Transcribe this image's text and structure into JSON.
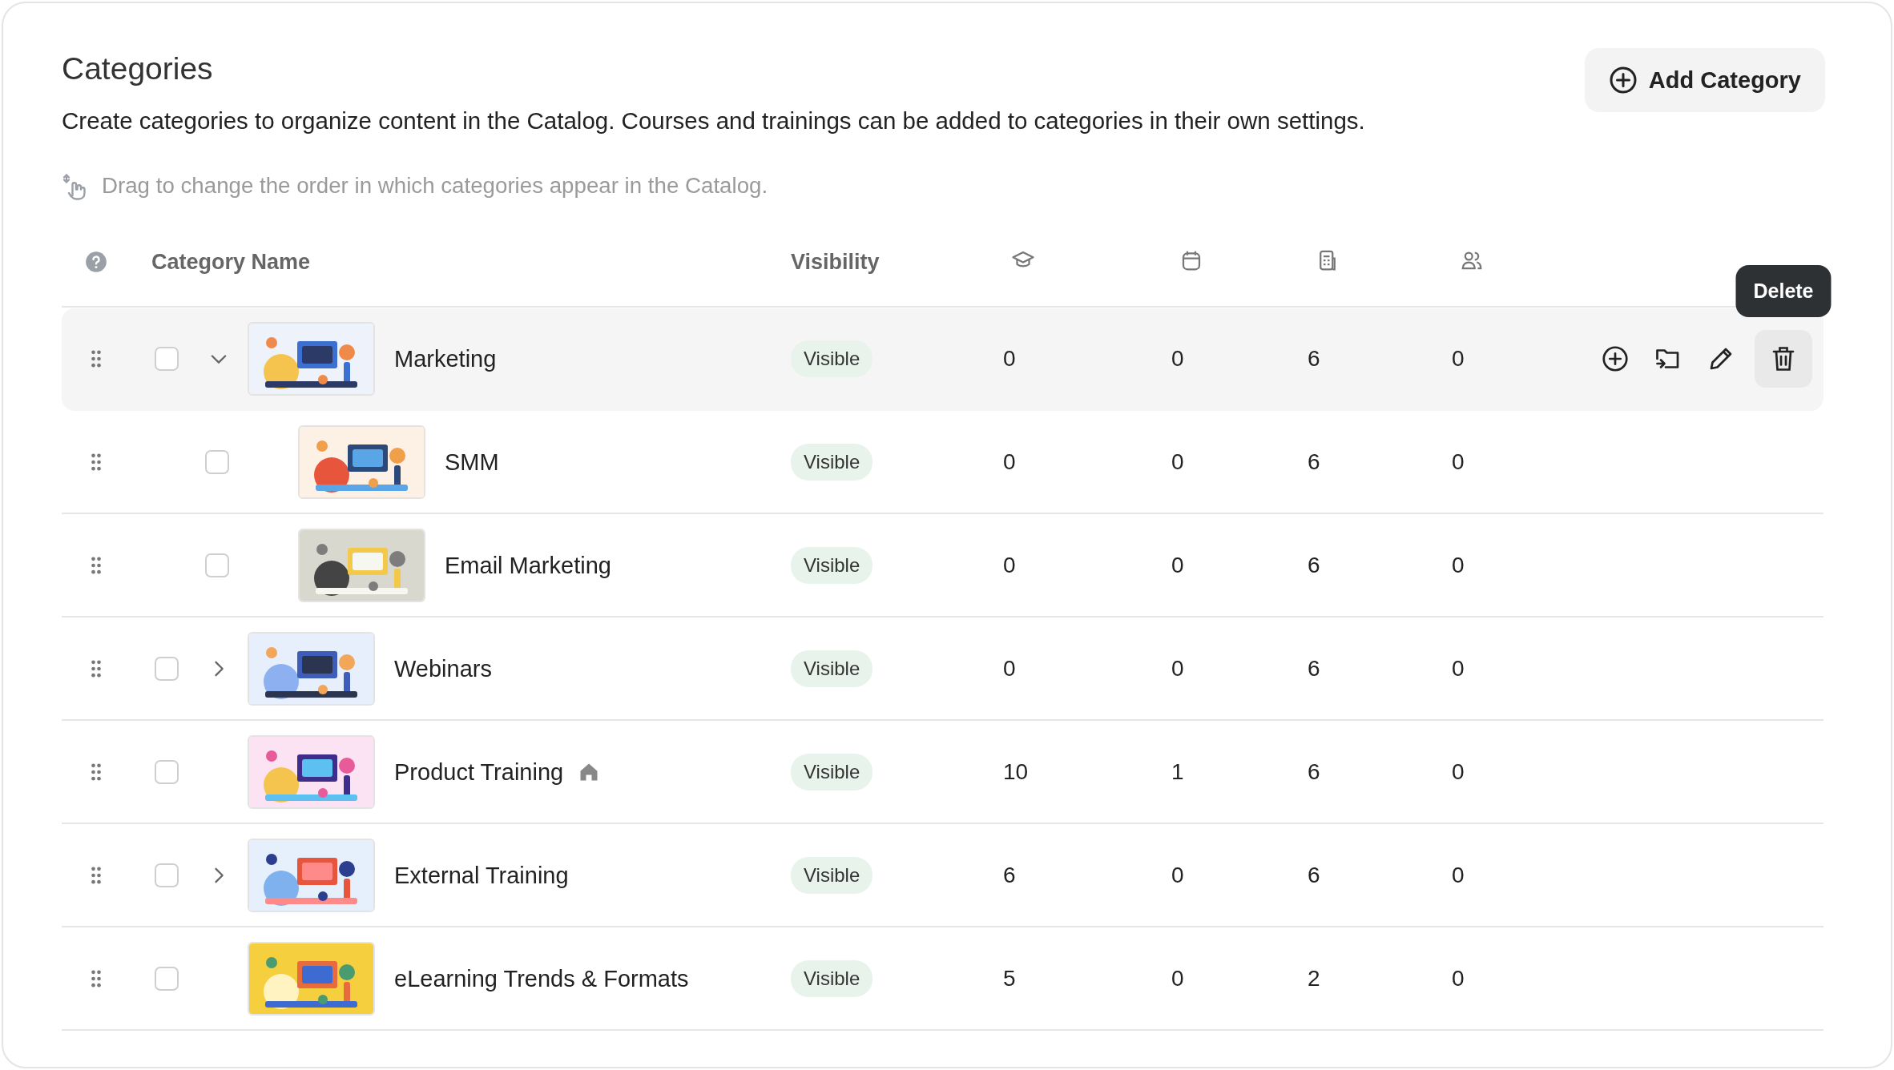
{
  "header": {
    "title": "Categories",
    "description": "Create categories to organize content in the Catalog. Courses and trainings can be added to categories in their own settings.",
    "hint": "Drag to change the order in which categories appear in the Catalog.",
    "add_button": "Add Category"
  },
  "table": {
    "columns": [
      {
        "label": "Category Name"
      },
      {
        "label": "Visibility"
      }
    ],
    "rows": [
      {
        "name": "Marketing",
        "visibility": "Visible",
        "counts": [
          "0",
          "0",
          "6",
          "0"
        ],
        "checked": false,
        "expanded": true,
        "home": false,
        "hovered": true,
        "tooltip": "Delete",
        "children": [
          {
            "name": "SMM",
            "visibility": "Visible",
            "counts": [
              "0",
              "0",
              "6",
              "0"
            ],
            "checked": false,
            "home": false,
            "hovered": false
          },
          {
            "name": "Email Marketing",
            "visibility": "Visible",
            "counts": [
              "0",
              "0",
              "6",
              "0"
            ],
            "checked": false,
            "home": false,
            "hovered": false
          }
        ]
      },
      {
        "name": "Webinars",
        "visibility": "Visible",
        "counts": [
          "0",
          "0",
          "6",
          "0"
        ],
        "checked": false,
        "expanded": false,
        "home": false,
        "hovered": false
      },
      {
        "name": "Product Training",
        "visibility": "Visible",
        "counts": [
          "10",
          "1",
          "6",
          "0"
        ],
        "checked": false,
        "home": true,
        "hovered": false
      },
      {
        "name": "External Training",
        "visibility": "Visible",
        "counts": [
          "6",
          "0",
          "6",
          "0"
        ],
        "checked": false,
        "expanded": false,
        "home": false,
        "hovered": false
      },
      {
        "name": "eLearning Trends & Formats",
        "visibility": "Visible",
        "counts": [
          "5",
          "0",
          "2",
          "0"
        ],
        "checked": false,
        "home": false,
        "hovered": false
      }
    ]
  }
}
